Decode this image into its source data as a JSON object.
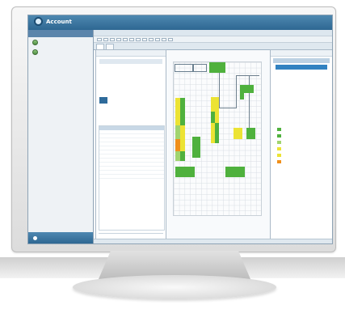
{
  "app": {
    "brand": "Account"
  },
  "topbar": {
    "right_items": [
      "",
      "",
      "",
      ""
    ]
  },
  "left_panel": {
    "title": "",
    "users": [
      "",
      ""
    ],
    "footer_label": ""
  },
  "main": {
    "menu": [
      "",
      "",
      "",
      "",
      "",
      ""
    ],
    "tabs": [
      "",
      ""
    ]
  },
  "calendar": {
    "title": "",
    "month": "",
    "weekdays": [
      "",
      "",
      "",
      "",
      "",
      "",
      ""
    ],
    "days": [
      "",
      "",
      "",
      "",
      "",
      "",
      "",
      "",
      "",
      "",
      "",
      "",
      "",
      "",
      "",
      "",
      "",
      "",
      "",
      "",
      "",
      "",
      "",
      "",
      "",
      "",
      "",
      "",
      "",
      "",
      "",
      "",
      "",
      "",
      ""
    ],
    "selected_day": "",
    "footer": "",
    "filter": "",
    "status_head": "",
    "bottom": ""
  },
  "properties": {
    "title": "",
    "tab": "",
    "active": "",
    "lines": [
      "",
      "",
      "",
      ""
    ],
    "legend": [
      "",
      "",
      "",
      "",
      "",
      ""
    ]
  },
  "status_bar": {
    "left": "",
    "right": ""
  },
  "colors": {
    "green": "#4fb13d",
    "yellow": "#ece334",
    "orange": "#f08f1a",
    "light_green": "#a1d46f",
    "blue": "#2f6b9b"
  }
}
